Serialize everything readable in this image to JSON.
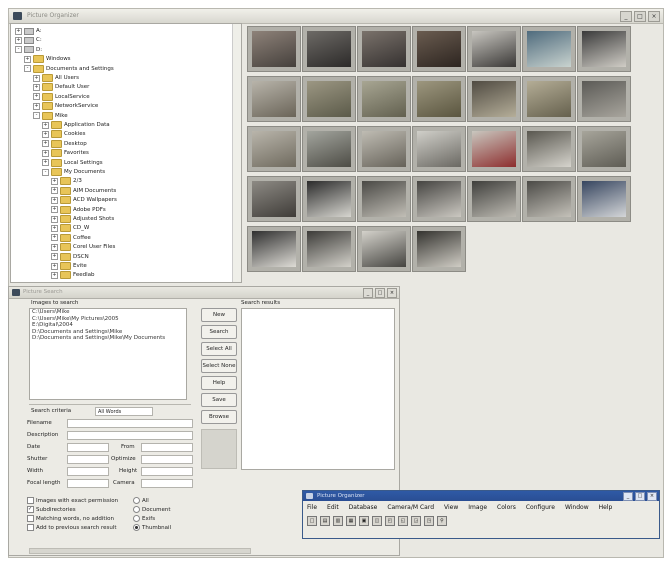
{
  "window": {
    "title": "Picture Organizer",
    "controls": [
      "_",
      "□",
      "×"
    ]
  },
  "tree": {
    "nodes": [
      {
        "label": "A:",
        "level": 0,
        "expander": "+",
        "kind": "drive"
      },
      {
        "label": "C:",
        "level": 0,
        "expander": "+",
        "kind": "drive"
      },
      {
        "label": "D:",
        "level": 0,
        "expander": "-",
        "kind": "drive"
      },
      {
        "label": "Windows",
        "level": 1,
        "expander": "+",
        "kind": "folder"
      },
      {
        "label": "Documents and Settings",
        "level": 1,
        "expander": "-",
        "kind": "folder"
      },
      {
        "label": "All Users",
        "level": 2,
        "expander": "+",
        "kind": "folder"
      },
      {
        "label": "Default User",
        "level": 2,
        "expander": "+",
        "kind": "folder"
      },
      {
        "label": "LocalService",
        "level": 2,
        "expander": "+",
        "kind": "folder"
      },
      {
        "label": "NetworkService",
        "level": 2,
        "expander": "+",
        "kind": "folder"
      },
      {
        "label": "Mike",
        "level": 2,
        "expander": "-",
        "kind": "folder"
      },
      {
        "label": "Application Data",
        "level": 3,
        "expander": "+",
        "kind": "folder"
      },
      {
        "label": "Cookies",
        "level": 3,
        "expander": "+",
        "kind": "folder"
      },
      {
        "label": "Desktop",
        "level": 3,
        "expander": "+",
        "kind": "folder"
      },
      {
        "label": "Favorites",
        "level": 3,
        "expander": "+",
        "kind": "folder"
      },
      {
        "label": "Local Settings",
        "level": 3,
        "expander": "+",
        "kind": "folder"
      },
      {
        "label": "My Documents",
        "level": 3,
        "expander": "-",
        "kind": "folder"
      },
      {
        "label": "2/3",
        "level": 4,
        "expander": "+",
        "kind": "folder"
      },
      {
        "label": "AIM Documents",
        "level": 4,
        "expander": "+",
        "kind": "folder"
      },
      {
        "label": "ACD Wallpapers",
        "level": 4,
        "expander": "+",
        "kind": "folder"
      },
      {
        "label": "Adobe PDFs",
        "level": 4,
        "expander": "+",
        "kind": "folder"
      },
      {
        "label": "Adjusted Shots",
        "level": 4,
        "expander": "+",
        "kind": "folder"
      },
      {
        "label": "CD_W",
        "level": 4,
        "expander": "+",
        "kind": "folder"
      },
      {
        "label": "Coffee",
        "level": 4,
        "expander": "+",
        "kind": "folder"
      },
      {
        "label": "Corel User Files",
        "level": 4,
        "expander": "+",
        "kind": "folder"
      },
      {
        "label": "DSCN",
        "level": 4,
        "expander": "+",
        "kind": "folder"
      },
      {
        "label": "Evite",
        "level": 4,
        "expander": "+",
        "kind": "folder"
      },
      {
        "label": "Feedlab",
        "level": 4,
        "expander": "+",
        "kind": "folder"
      }
    ]
  },
  "thumbnails": [
    {
      "c1": "#8e8279",
      "c2": "#45403c"
    },
    {
      "c1": "#6d6a66",
      "c2": "#2c2a29"
    },
    {
      "c1": "#7a726b",
      "c2": "#353130"
    },
    {
      "c1": "#6a5c50",
      "c2": "#2d2520"
    },
    {
      "c1": "#c8c6c0",
      "c2": "#3a3836"
    },
    {
      "c1": "#4f6b7d",
      "c2": "#c9d3cf"
    },
    {
      "c1": "#3a3a3a",
      "c2": "#d0cdc6"
    },
    {
      "c1": "#b8b4aa",
      "c2": "#6a6458"
    },
    {
      "c1": "#9c9783",
      "c2": "#5b5a49"
    },
    {
      "c1": "#a8a693",
      "c2": "#62604f"
    },
    {
      "c1": "#9d977f",
      "c2": "#5a553f"
    },
    {
      "c1": "#504b42",
      "c2": "#b5ae99"
    },
    {
      "c1": "#b4ad96",
      "c2": "#65604d"
    },
    {
      "c1": "#5b5a56",
      "c2": "#a8a59d"
    },
    {
      "c1": "#b9b5ab",
      "c2": "#6f6a5e"
    },
    {
      "c1": "#a3a59e",
      "c2": "#4d4c45"
    },
    {
      "c1": "#bfbcb3",
      "c2": "#666259"
    },
    {
      "c1": "#d0cfc9",
      "c2": "#6a6862"
    },
    {
      "c1": "#c9c7bf",
      "c2": "#8d2d2d"
    },
    {
      "c1": "#59574f",
      "c2": "#d6d4cd"
    },
    {
      "c1": "#a7a59b",
      "c2": "#5e5c54"
    },
    {
      "c1": "#8d8a84",
      "c2": "#3f3c38"
    },
    {
      "c1": "#2b2b2b",
      "c2": "#d7d6d0"
    },
    {
      "c1": "#4a4945",
      "c2": "#c1beb6"
    },
    {
      "c1": "#454441",
      "c2": "#cbc8c1"
    },
    {
      "c1": "#3f3f3c",
      "c2": "#bebbb3"
    },
    {
      "c1": "#4b4a46",
      "c2": "#c4c1b9"
    },
    {
      "c1": "#36455f",
      "c2": "#d4d6d8"
    },
    {
      "c1": "#2f2f2f",
      "c2": "#dedcd6"
    },
    {
      "c1": "#3c3b38",
      "c2": "#d3d1ca"
    },
    {
      "c1": "#d4d2cb",
      "c2": "#454440"
    },
    {
      "c1": "#34332f",
      "c2": "#cfccc4"
    }
  ],
  "search": {
    "title": "Picture Search",
    "images_label": "Images to search",
    "paths": [
      "C:\\Users\\Mike",
      "C:\\Users\\Mike\\My Pictures\\2005",
      "E:\\Digital\\2004",
      "D:\\Documents and Settings\\Mike",
      "D:\\Documents and Settings\\Mike\\My Documents"
    ],
    "buttons": [
      "New",
      "Search",
      "Select All",
      "Select None",
      "Help",
      "Save",
      "Browse"
    ],
    "results_label": "Search results",
    "criteria_label": "Search criteria",
    "criteria_value": "All Words",
    "filename_label": "Filename",
    "description_label": "Description",
    "date_label": "Date",
    "date_from_label": "From",
    "shutter_label": "Shutter",
    "shutter_opt_label": "Optimize",
    "width_label": "Width",
    "height_label": "Height",
    "focal_label": "Focal length",
    "camera_label": "Camera",
    "checkbox_options": [
      {
        "label": "Images with exact permission",
        "checked": false
      },
      {
        "label": "Subdirectories",
        "checked": true
      },
      {
        "label": "Matching words, no addition",
        "checked": false
      },
      {
        "label": "Add to previous search result",
        "checked": false
      }
    ],
    "radio_options": [
      {
        "label": "All",
        "on": false
      },
      {
        "label": "Document",
        "on": false
      },
      {
        "label": "Exifs",
        "on": false
      },
      {
        "label": "Thumbnail",
        "on": true
      }
    ]
  },
  "toolbar_window": {
    "title": "Picture Organizer",
    "menus": [
      "File",
      "Edit",
      "Database",
      "Camera/M Card",
      "View",
      "Image",
      "Colors",
      "Configure",
      "Window",
      "Help"
    ],
    "tools": [
      "□",
      "▤",
      "▥",
      "▦",
      "▣",
      "◫",
      "◰",
      "◱",
      "◲",
      "◳",
      "⚲"
    ]
  }
}
